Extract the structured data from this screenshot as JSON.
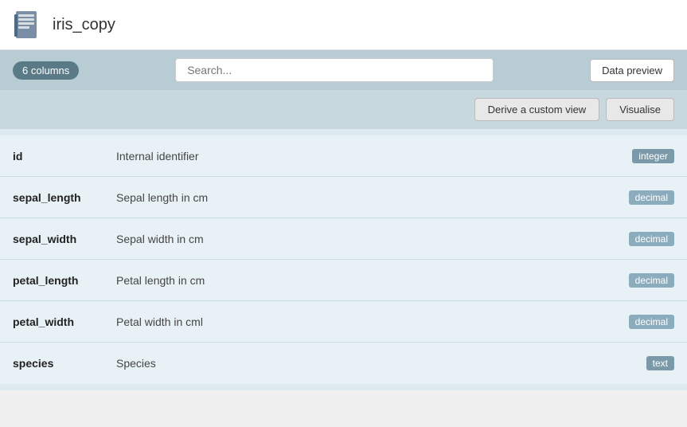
{
  "header": {
    "title": "iris_copy"
  },
  "toolbar": {
    "columns_badge": "6 columns",
    "search_placeholder": "Search...",
    "data_preview_label": "Data preview"
  },
  "action_toolbar": {
    "derive_label": "Derive a custom view",
    "visualise_label": "Visualise"
  },
  "fields": [
    {
      "name": "id",
      "description": "Internal identifier",
      "type": "integer"
    },
    {
      "name": "sepal_length",
      "description": "Sepal length in cm",
      "type": "decimal"
    },
    {
      "name": "sepal_width",
      "description": "Sepal width in cm",
      "type": "decimal"
    },
    {
      "name": "petal_length",
      "description": "Petal length in cm",
      "type": "decimal"
    },
    {
      "name": "petal_width",
      "description": "Petal width in cml",
      "type": "decimal"
    },
    {
      "name": "species",
      "description": "Species",
      "type": "text"
    }
  ]
}
